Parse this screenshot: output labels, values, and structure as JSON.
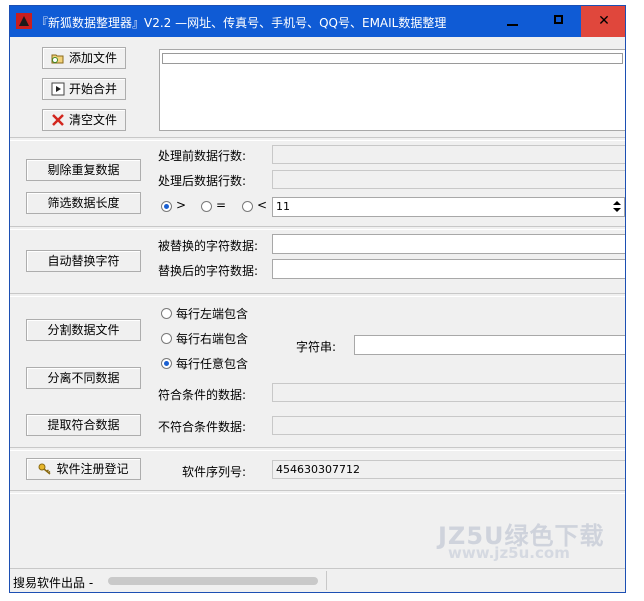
{
  "window": {
    "title": "『新狐数据整理器』V2.2 —网址、传真号、手机号、QQ号、EMAIL数据整理",
    "min_glyph": "",
    "max_glyph": "",
    "close_glyph": "✕"
  },
  "file_buttons": {
    "add": "添加文件",
    "merge": "开始合并",
    "clear": "清空文件"
  },
  "dedupe": {
    "button": "剔除重复数据",
    "before_label": "处理前数据行数:",
    "before_value": "",
    "after_label": "处理后数据行数:",
    "after_value": ""
  },
  "length_filter": {
    "button": "筛选数据长度",
    "options": [
      ">",
      "=",
      "<"
    ],
    "selected": ">",
    "value": "11"
  },
  "replace": {
    "button": "自动替换字符",
    "from_label": "被替换的字符数据:",
    "from_value": "",
    "to_label": "替换后的字符数据:",
    "to_value": ""
  },
  "split": {
    "split_button": "分割数据文件",
    "separate_button": "分离不同数据",
    "extract_button": "提取符合数据",
    "options": [
      "每行左端包含",
      "每行右端包含",
      "每行任意包含"
    ],
    "selected": "每行任意包含",
    "string_label": "字符串:",
    "string_value": "",
    "match_label": "符合条件的数据:",
    "match_value": "",
    "nomatch_label": "不符合条件数据:",
    "nomatch_value": ""
  },
  "register": {
    "button": "软件注册登记",
    "serial_label": "软件序列号:",
    "serial_value": "454630307712"
  },
  "status": {
    "text": "搜易软件出品 -"
  },
  "watermark": {
    "line1": "JZ5U绿色下载",
    "line2": "www.jz5u.com"
  }
}
